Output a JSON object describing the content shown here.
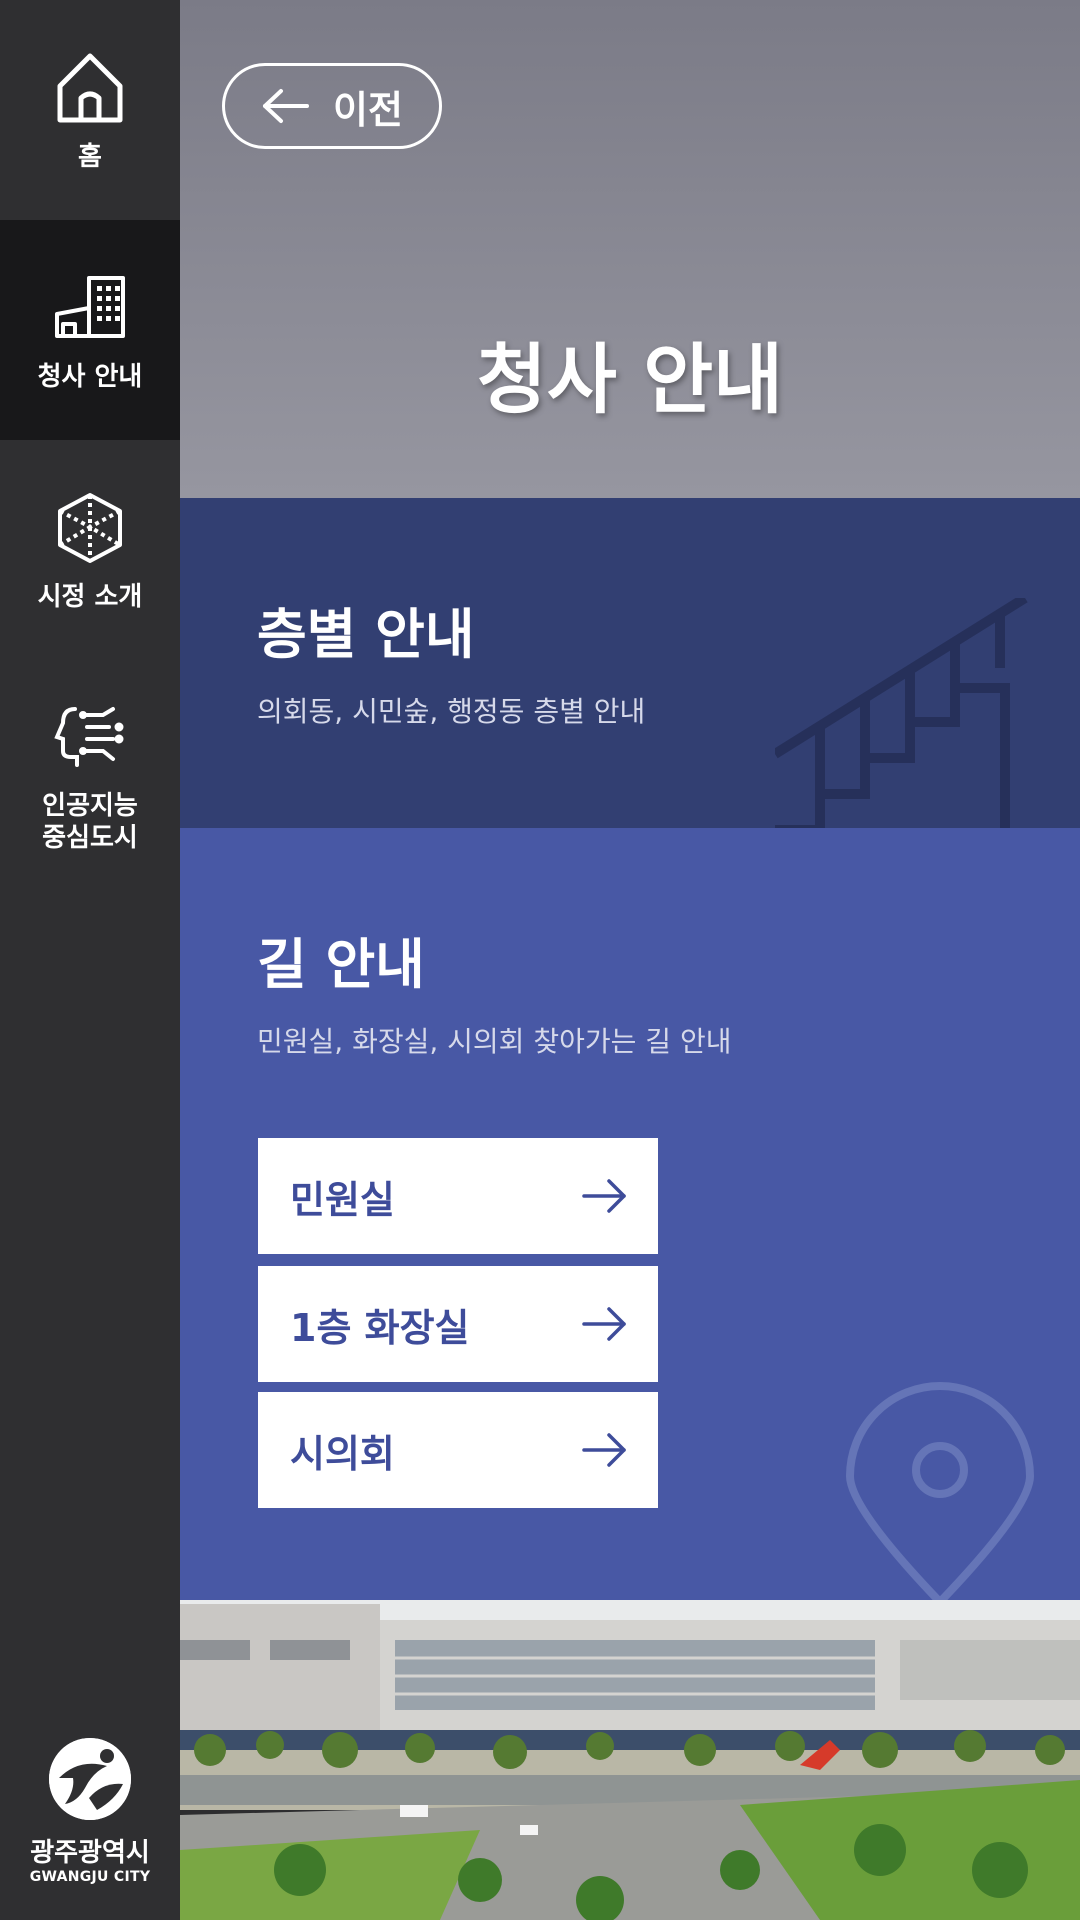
{
  "sidebar": {
    "items": [
      {
        "label": "홈",
        "icon": "home-icon"
      },
      {
        "label": "청사 안내",
        "icon": "building-icon",
        "active": true
      },
      {
        "label": "시정 소개",
        "icon": "cube-icon"
      },
      {
        "label": "인공지능\n중심도시",
        "icon": "ai-head-icon"
      }
    ],
    "logo": {
      "name": "광주광역시",
      "sub": "GWANGJU CITY"
    }
  },
  "header": {
    "back_label": "이전",
    "title": "청사 안내"
  },
  "floor_guide": {
    "title": "층별 안내",
    "description": "의회동, 시민숲, 행정동 층별 안내"
  },
  "route_guide": {
    "title": "길 안내",
    "description": "민원실, 화장실, 시의회 찾아가는 길 안내",
    "buttons": [
      {
        "label": "민원실"
      },
      {
        "label": "1층 화장실"
      },
      {
        "label": "시의회"
      }
    ]
  },
  "colors": {
    "sidebar_bg": "#2f2f31",
    "sidebar_active": "#18181a",
    "header_bg": "#8a8a95",
    "floor_bg": "#323f72",
    "route_bg": "#4858a5",
    "button_text": "#3e4c9a"
  }
}
